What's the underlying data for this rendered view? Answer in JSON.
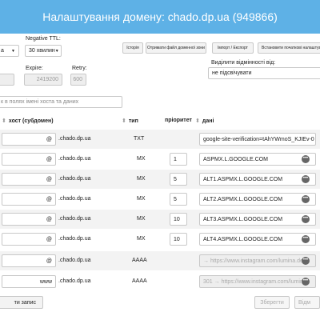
{
  "header": {
    "title": "Налаштування домену: chado.dp.ua (949866)"
  },
  "settings": {
    "negative_ttl_label": "Negative TTL:",
    "negative_ttl_value": "30 хвилин",
    "left_select_value": "а",
    "expire_label": "Expire:",
    "expire_value": "2419200",
    "retry_label": "Retry:",
    "retry_value": "600",
    "highlight_label": "Виділити відмінності від:",
    "highlight_value": "не підсвічувати"
  },
  "toolbar": {
    "history": "Історія",
    "get_zone_file": "Отримати файл доменної зони",
    "import_export": "Імпорт / Експорт",
    "set_defaults": "Встановити початкові налаштування"
  },
  "search": {
    "placeholder": "к в полях імені хоста та даних"
  },
  "table": {
    "columns": {
      "host": "хост (субдомен)",
      "type": "тип",
      "priority": "пріоритет",
      "data": "дані"
    },
    "rows": [
      {
        "host": "",
        "suffix": "@",
        "domain": ".chado.dp.ua",
        "type": "TXT",
        "priority": "",
        "data": "google-site-verification=tAhYWmoS_KJIEv-0"
      },
      {
        "host": "",
        "suffix": "@",
        "domain": ".chado.dp.ua",
        "type": "MX",
        "priority": "1",
        "data": "ASPMX.L.GOOGLE.COM"
      },
      {
        "host": "",
        "suffix": "@",
        "domain": ".chado.dp.ua",
        "type": "MX",
        "priority": "5",
        "data": "ALT1.ASPMX.L.GOOGLE.COM"
      },
      {
        "host": "",
        "suffix": "@",
        "domain": ".chado.dp.ua",
        "type": "MX",
        "priority": "5",
        "data": "ALT2.ASPMX.L.GOOGLE.COM"
      },
      {
        "host": "",
        "suffix": "@",
        "domain": ".chado.dp.ua",
        "type": "MX",
        "priority": "10",
        "data": "ALT3.ASPMX.L.GOOGLE.COM"
      },
      {
        "host": "",
        "suffix": "@",
        "domain": ".chado.dp.ua",
        "type": "MX",
        "priority": "10",
        "data": "ALT4.ASPMX.L.GOOGLE.COM"
      },
      {
        "host": "",
        "suffix": "@",
        "domain": ".chado.dp.ua",
        "type": "AAAA",
        "priority": "",
        "data": "→ https://www.instagram.com/lumina.dec"
      },
      {
        "host": "",
        "suffix": "www",
        "domain": ".chado.dp.ua",
        "type": "AAAA",
        "priority": "",
        "data": "301 → https://www.instagram.com/lumina"
      }
    ]
  },
  "footer": {
    "add_record": "ти запис",
    "save": "Зберегти",
    "revert": "Відм"
  }
}
